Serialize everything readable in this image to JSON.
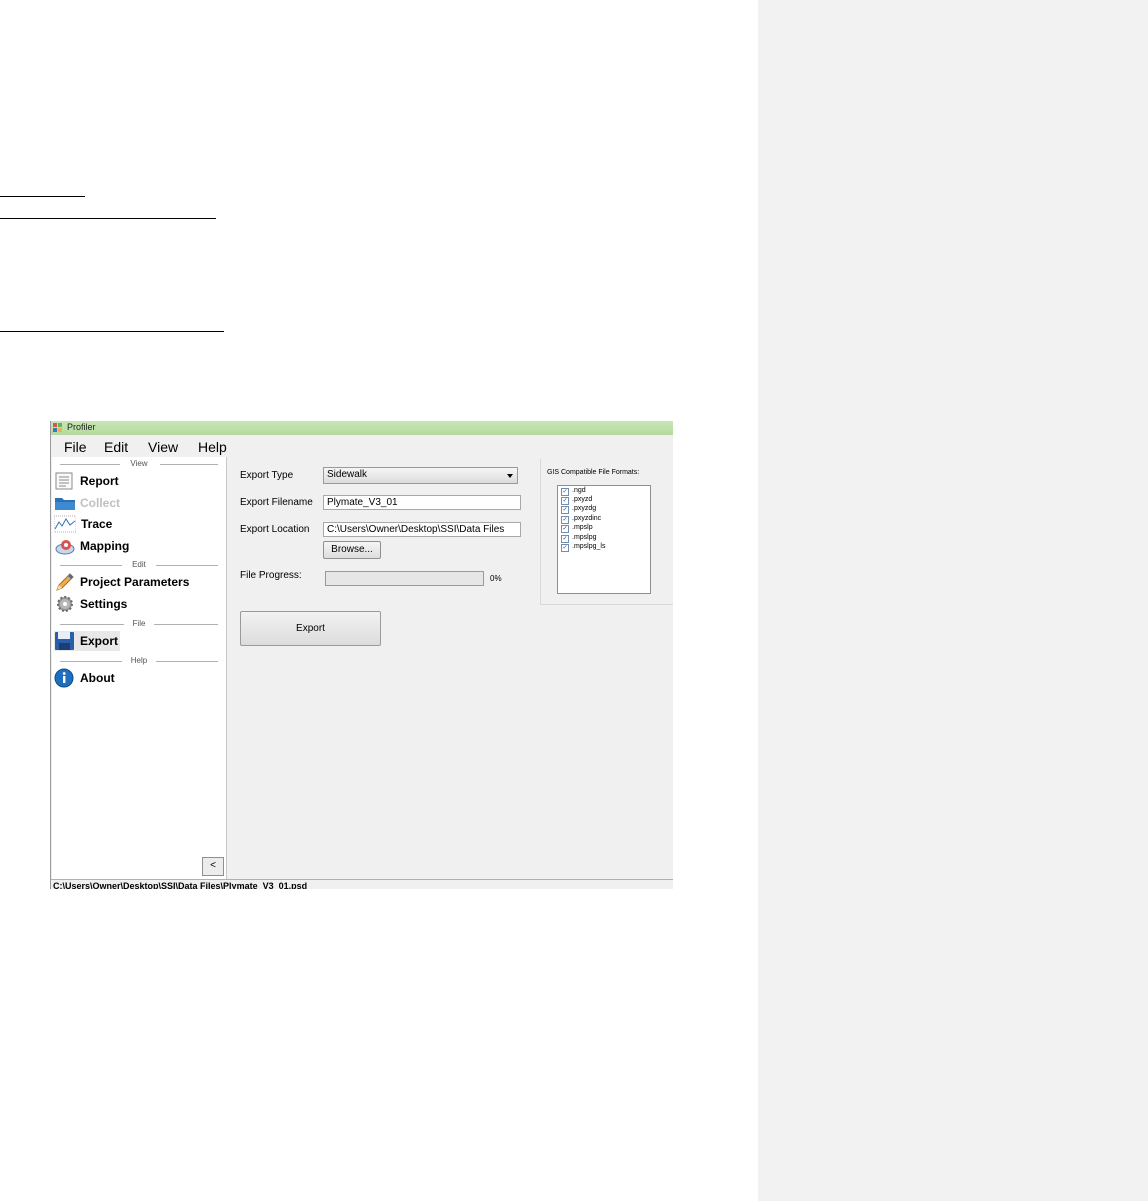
{
  "window": {
    "title": "Profiler"
  },
  "menu": [
    {
      "label": "File"
    },
    {
      "label": "Edit"
    },
    {
      "label": "View"
    },
    {
      "label": "Help"
    }
  ],
  "sidebar": {
    "sections": {
      "view": "View",
      "edit": "Edit",
      "file": "File",
      "help": "Help"
    },
    "items": [
      {
        "label": "Report",
        "icon": "report-icon",
        "enabled": true
      },
      {
        "label": "Collect",
        "icon": "folder-icon",
        "enabled": false
      },
      {
        "label": "Trace",
        "icon": "trace-chart-icon",
        "enabled": true
      },
      {
        "label": "Mapping",
        "icon": "globe-icon",
        "enabled": true
      },
      {
        "label": "Project Parameters",
        "icon": "pencil-icon",
        "enabled": true
      },
      {
        "label": "Settings",
        "icon": "gear-icon",
        "enabled": true
      },
      {
        "label": "Export",
        "icon": "floppy-disk-icon",
        "enabled": true,
        "selected": true
      },
      {
        "label": "About",
        "icon": "info-icon",
        "enabled": true
      }
    ],
    "collapse_label": "<"
  },
  "export": {
    "type_label": "Export Type",
    "type_value": "Sidewalk",
    "filename_label": "Export Filename",
    "filename_value": "Plymate_V3_01",
    "location_label": "Export Location",
    "location_value": "C:\\Users\\Owner\\Desktop\\SSI\\Data Files",
    "browse_label": "Browse...",
    "progress_label": "File Progress:",
    "progress_percent": 0,
    "progress_text": "0%",
    "export_button": "Export"
  },
  "gis": {
    "title": "GIS Compatible File Formats:",
    "formats": [
      {
        "label": ".ngd",
        "checked": true
      },
      {
        "label": ".pxyzd",
        "checked": true
      },
      {
        "label": ".pxyzdg",
        "checked": true
      },
      {
        "label": ".pxyzdinc",
        "checked": true
      },
      {
        "label": ".mpslp",
        "checked": true
      },
      {
        "label": ".mpslpg",
        "checked": true
      },
      {
        "label": ".mpslpg_ls",
        "checked": true
      }
    ]
  },
  "status": {
    "path": "C:\\Users\\Owner\\Desktop\\SSI\\Data Files\\Plymate_V3_01.psd"
  },
  "colors": {
    "progress_fill": "#5fc95f",
    "titlebar": "#c7e6b4",
    "margin_panel": "#f2f2f2"
  }
}
